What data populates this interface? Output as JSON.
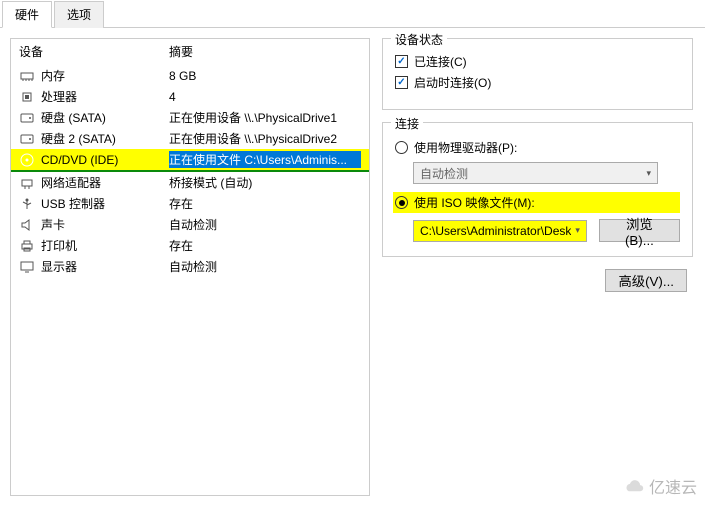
{
  "tabs": {
    "hardware": "硬件",
    "options": "选项"
  },
  "headers": {
    "device": "设备",
    "summary": "摘要"
  },
  "devices": [
    {
      "name": "内存",
      "summary": "8 GB",
      "icon": "memory"
    },
    {
      "name": "处理器",
      "summary": "4",
      "icon": "cpu"
    },
    {
      "name": "硬盘 (SATA)",
      "summary": "正在使用设备 \\\\.\\PhysicalDrive1",
      "icon": "disk"
    },
    {
      "name": "硬盘 2 (SATA)",
      "summary": "正在使用设备 \\\\.\\PhysicalDrive2",
      "icon": "disk"
    },
    {
      "name": "CD/DVD (IDE)",
      "summary": "正在使用文件 C:\\Users\\Adminis...",
      "icon": "cd",
      "selected": true
    },
    {
      "name": "网络适配器",
      "summary": "桥接模式 (自动)",
      "icon": "net"
    },
    {
      "name": "USB 控制器",
      "summary": "存在",
      "icon": "usb"
    },
    {
      "name": "声卡",
      "summary": "自动检测",
      "icon": "sound"
    },
    {
      "name": "打印机",
      "summary": "存在",
      "icon": "printer"
    },
    {
      "name": "显示器",
      "summary": "自动检测",
      "icon": "display"
    }
  ],
  "status": {
    "title": "设备状态",
    "connected": "已连接(C)",
    "poweron": "启动时连接(O)"
  },
  "connection": {
    "title": "连接",
    "physical": "使用物理驱动器(P):",
    "autodetect": "自动检测",
    "useiso": "使用 ISO 映像文件(M):",
    "isopath": "C:\\Users\\Administrator\\Desk",
    "browse": "浏览(B)..."
  },
  "advanced": "高级(V)...",
  "watermark": "亿速云"
}
